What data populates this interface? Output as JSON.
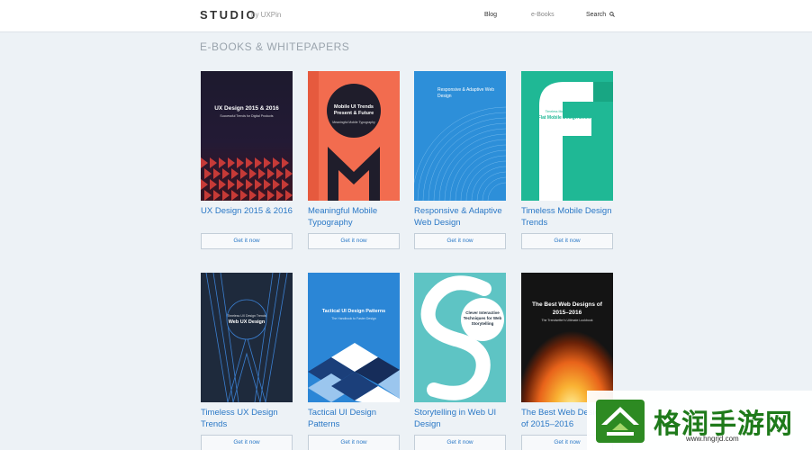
{
  "header": {
    "logo": "STUDIO",
    "logo_by": "by UXPin",
    "nav": {
      "blog": "Blog",
      "ebooks": "e-Books",
      "search": "Search"
    }
  },
  "section_title": "E-BOOKS & WHITEPAPERS",
  "cta_label": "Get it now",
  "books": [
    {
      "title": "UX Design 2015 & 2016",
      "cover_title": "UX Design 2015 & 2016",
      "cover_sub": "Successful Trends for Digital Products"
    },
    {
      "title": "Meaningful Mobile Typography",
      "cover_title": "Mobile UI Trends Present & Future",
      "cover_sub": "Meaningful Mobile Typography"
    },
    {
      "title": "Responsive & Adaptive Web Design",
      "cover_title": "Responsive & Adaptive Web Design",
      "cover_sub": ""
    },
    {
      "title": "Timeless Mobile Design Trends",
      "cover_title": "Flat Mobile Design Evolved",
      "cover_sub": "Timeless Mobile Design Trends"
    },
    {
      "title": "Timeless UX Design Trends",
      "cover_title": "Web UX Design",
      "cover_sub": "Timeless UX Design Trends"
    },
    {
      "title": "Tactical UI Design Patterns",
      "cover_title": "Tactical UI Design Patterns",
      "cover_sub": "The Handbook to Faster Design"
    },
    {
      "title": "Storytelling in Web UI Design",
      "cover_title": "Clever Interactive Techniques for Web Storytelling",
      "cover_sub": ""
    },
    {
      "title": "The Best Web Designs of 2015–2016",
      "cover_title": "The Best Web Designs of 2015–2016",
      "cover_sub": "The Trendsetter's Ultimate Lookbook"
    }
  ],
  "watermark": {
    "text": "格润手游网",
    "url": "www.hngrjd.com"
  },
  "colors": {
    "link": "#2a78c6",
    "background": "#edf2f6",
    "cover_1": "#1d1a2e",
    "cover_2": "#f26c4f",
    "cover_3": "#2d8fd9",
    "cover_4": "#1fb895",
    "cover_5": "#1e2a3c",
    "cover_6": "#2b86d6",
    "cover_7": "#5ec4c4",
    "cover_8": "#141414"
  }
}
